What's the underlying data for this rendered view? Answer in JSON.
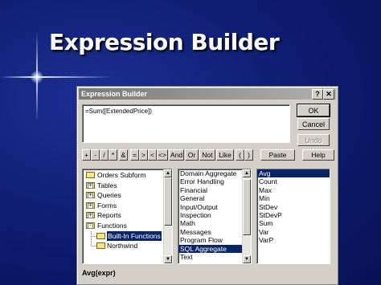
{
  "slide": {
    "title": "Expression Builder"
  },
  "dialog": {
    "title": "Expression Builder",
    "help_glyph": "?",
    "close_glyph": "✕",
    "expression": "=Sum([ExtendedPrice])",
    "buttons": {
      "ok": "OK",
      "cancel": "Cancel",
      "undo": "Undo",
      "paste": "Paste",
      "help": "Help"
    },
    "operators": [
      "+",
      "-",
      "/",
      "*",
      "&",
      "=",
      ">",
      "<",
      "<>",
      "And",
      "Or",
      "Not",
      "Like",
      "(",
      ")"
    ],
    "tree": [
      {
        "label": "Orders Subform",
        "icon": "folder-icon",
        "expander": "none"
      },
      {
        "label": "Tables",
        "icon": "folder-icon",
        "expander": "+"
      },
      {
        "label": "Queries",
        "icon": "folder-icon",
        "expander": "+"
      },
      {
        "label": "Forms",
        "icon": "folder-icon",
        "expander": "+"
      },
      {
        "label": "Reports",
        "icon": "folder-icon",
        "expander": "+"
      },
      {
        "label": "Functions",
        "icon": "folder-icon",
        "expander": "-"
      },
      {
        "label": "Built-In Functions",
        "icon": "open-folder-icon",
        "expander": "child",
        "selected": true
      },
      {
        "label": "Northwind",
        "icon": "folder-icon",
        "expander": "child"
      }
    ],
    "categories": [
      "Domain Aggregate",
      "Error Handling",
      "Financial",
      "General",
      "Input/Output",
      "Inspection",
      "Math",
      "Messages",
      "Program Flow",
      "SQL Aggregate",
      "Text"
    ],
    "selected_category": "SQL Aggregate",
    "functions": [
      "Avg",
      "Count",
      "Max",
      "Min",
      "StDev",
      "StDevP",
      "Sum",
      "Var",
      "VarP"
    ],
    "selected_function": "Avg",
    "status": "Avg(expr)"
  }
}
